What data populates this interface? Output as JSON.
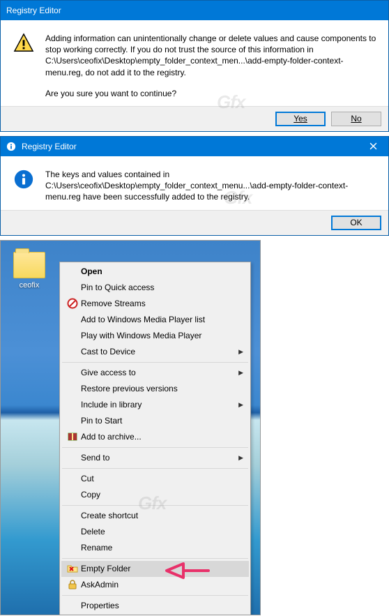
{
  "dialog1": {
    "title": "Registry Editor",
    "body1": "Adding information can unintentionally change or delete values and cause components to stop working correctly. If you do not trust the source of this information in C:\\Users\\ceofix\\Desktop\\empty_folder_context_men...\\add-empty-folder-context-menu.reg, do not add it to the registry.",
    "body2": "Are you sure you want to continue?",
    "yes": "Yes",
    "no": "No"
  },
  "dialog2": {
    "title": "Registry Editor",
    "body": "The keys and values contained in C:\\Users\\ceofix\\Desktop\\empty_folder_context_menu...\\add-empty-folder-context-menu.reg have been successfully added to the registry.",
    "ok": "OK"
  },
  "desktop": {
    "icon_label": "ceofix"
  },
  "menu": {
    "items": [
      {
        "label": "Open",
        "bold": true
      },
      {
        "label": "Pin to Quick access"
      },
      {
        "label": "Remove Streams",
        "icon": "no-entry"
      },
      {
        "label": "Add to Windows Media Player list"
      },
      {
        "label": "Play with Windows Media Player"
      },
      {
        "label": "Cast to Device",
        "submenu": true
      },
      {
        "sep": true
      },
      {
        "label": "Give access to",
        "submenu": true
      },
      {
        "label": "Restore previous versions"
      },
      {
        "label": "Include in library",
        "submenu": true
      },
      {
        "label": "Pin to Start"
      },
      {
        "label": "Add to archive...",
        "icon": "archive"
      },
      {
        "sep": true
      },
      {
        "label": "Send to",
        "submenu": true
      },
      {
        "sep": true
      },
      {
        "label": "Cut"
      },
      {
        "label": "Copy"
      },
      {
        "sep": true
      },
      {
        "label": "Create shortcut"
      },
      {
        "label": "Delete"
      },
      {
        "label": "Rename"
      },
      {
        "sep": true
      },
      {
        "label": "Empty Folder",
        "icon": "folder-x",
        "hl": true
      },
      {
        "label": "AskAdmin",
        "icon": "lock"
      },
      {
        "sep": true
      },
      {
        "label": "Properties"
      }
    ]
  },
  "watermark": "Gfx"
}
